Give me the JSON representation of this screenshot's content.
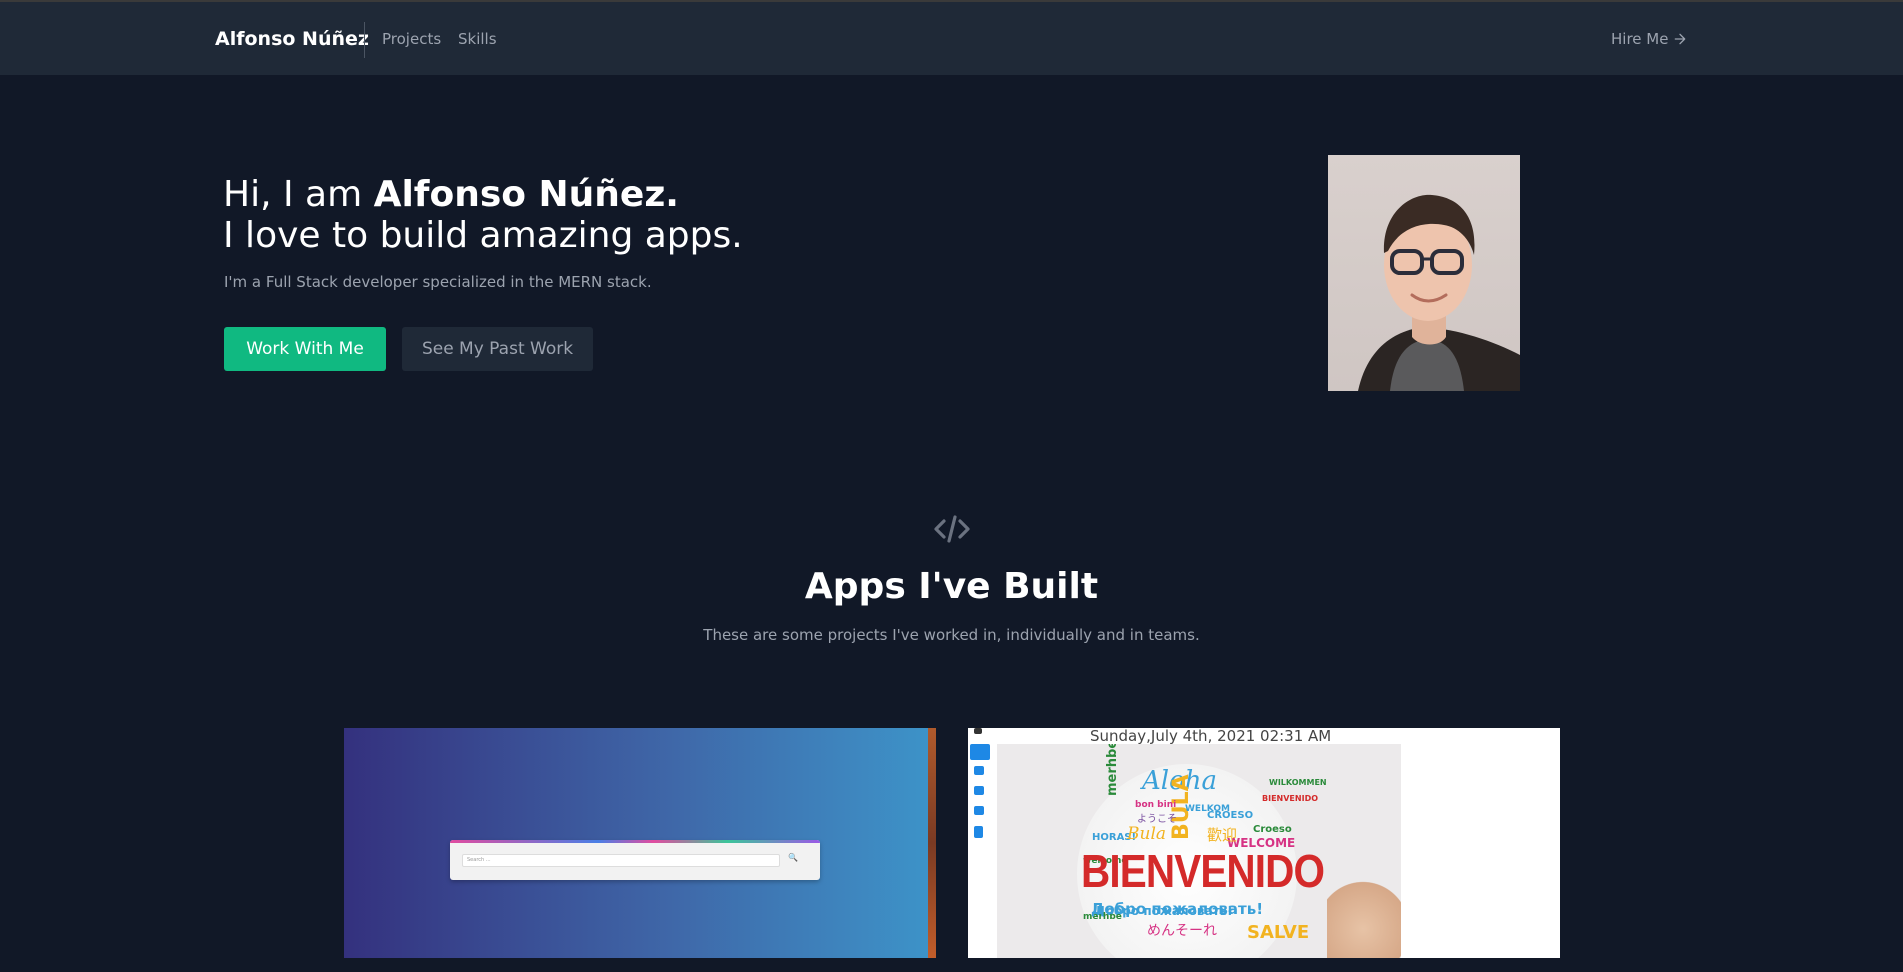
{
  "nav": {
    "brand": "Alfonso Núñez",
    "links": [
      {
        "label": "Projects"
      },
      {
        "label": "Skills"
      }
    ],
    "hire_me": "Hire Me",
    "hire_me_icon": "arrow-right-icon"
  },
  "hero": {
    "greeting": "Hi, I am ",
    "name": "Alfonso Núñez.",
    "tagline": "I love to build amazing apps.",
    "subtitle": "I'm a Full Stack developer specialized in the MERN stack.",
    "primary_button": "Work With Me",
    "secondary_button": "See My Past Work",
    "colors": {
      "primary": "#10b981",
      "background": "#111827",
      "surface": "#1f2937"
    }
  },
  "projects_section": {
    "icon": "code-icon",
    "title": "Apps I've Built",
    "subtitle": "These are some projects I've worked in, individually and in teams."
  },
  "projects": [
    {
      "search_placeholder": "Search ..."
    },
    {
      "datetime": "Sunday,July 4th, 2021 02:31 AM",
      "banner_text": "BIENVENIDO",
      "words": [
        "Aloha",
        "merhbe",
        "BULA",
        "HORAS!",
        "Bula",
        "CROESO",
        "WELCOME",
        "SALVE",
        "Добро пожаловать!",
        "めんそーれ",
        "歡迎",
        "ようこそ",
        "Croeso",
        "bon bini",
        "WILKOMMEN",
        "BIENVENIDO",
        "WELKOM",
        "merhbe",
        "welcome"
      ]
    }
  ]
}
